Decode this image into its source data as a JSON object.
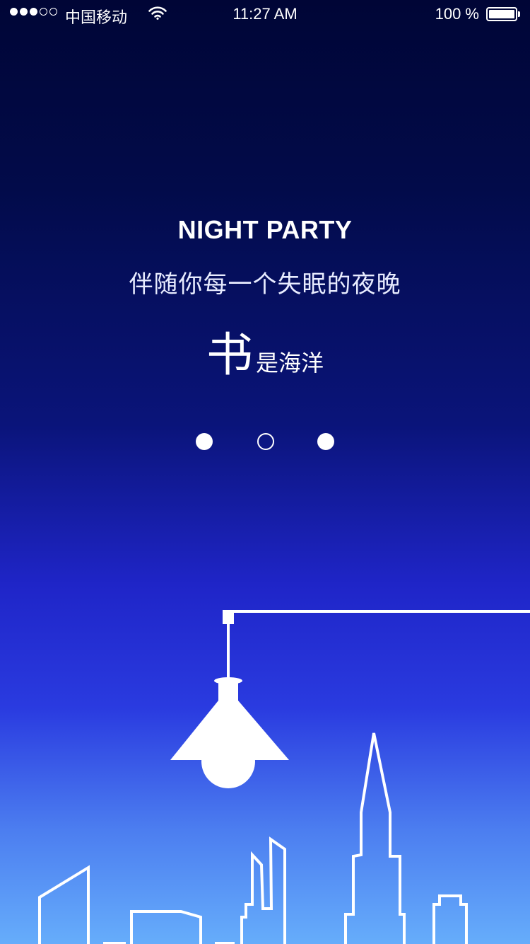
{
  "status_bar": {
    "carrier": "中国移动",
    "time": "11:27 AM",
    "battery_percent": "100 %",
    "signal_bars_filled": 3,
    "signal_bars_total": 5,
    "wifi_icon": "wifi-icon",
    "battery_icon": "battery-full-icon"
  },
  "splash": {
    "title": "NIGHT PARTY",
    "subtitle": "伴随你每一个失眠的夜晚",
    "slogan_big": "书",
    "slogan_small": "是海洋"
  },
  "pager": {
    "total": 3,
    "current_index": 1
  },
  "illustration": {
    "icons": [
      "pendant-lamp-icon",
      "city-skyline-icon"
    ]
  },
  "colors": {
    "background_top": "#000536",
    "background_mid": "#1f25c8",
    "background_bottom": "#66adfb",
    "foreground": "#ffffff"
  }
}
